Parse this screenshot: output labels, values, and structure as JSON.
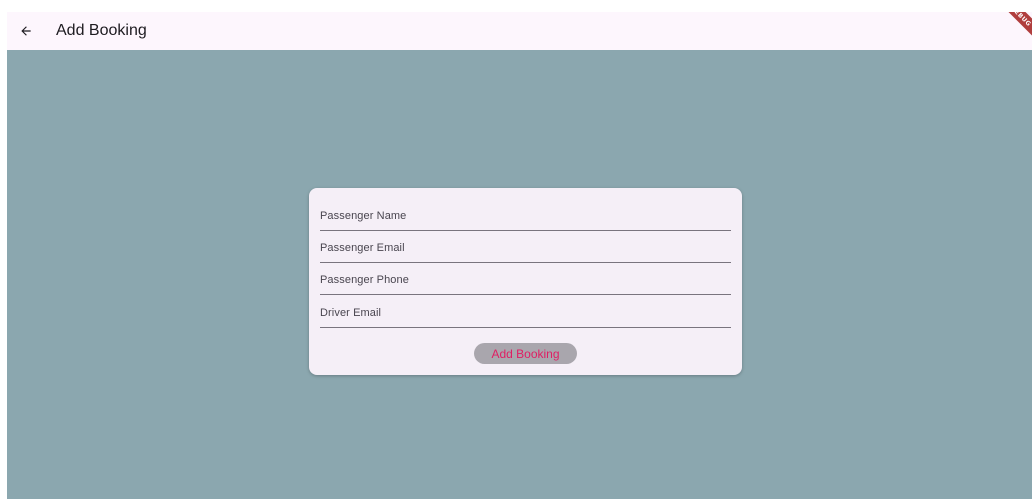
{
  "appbar": {
    "back_icon": "arrow-back-icon",
    "title": "Add Booking"
  },
  "debug_banner": {
    "label": "DEBUG",
    "color": "#b03e3e"
  },
  "form": {
    "fields": [
      {
        "label": "Passenger Name",
        "value": ""
      },
      {
        "label": "Passenger Email",
        "value": ""
      },
      {
        "label": "Passenger Phone",
        "value": ""
      },
      {
        "label": "Driver Email",
        "value": ""
      }
    ],
    "submit_label": "Add Booking"
  },
  "colors": {
    "background": "#8ba7af",
    "appbar": "#fdf6fd",
    "card": "#f5eff7",
    "button_bg": "#a9a6ad",
    "button_text": "#e01e63"
  }
}
